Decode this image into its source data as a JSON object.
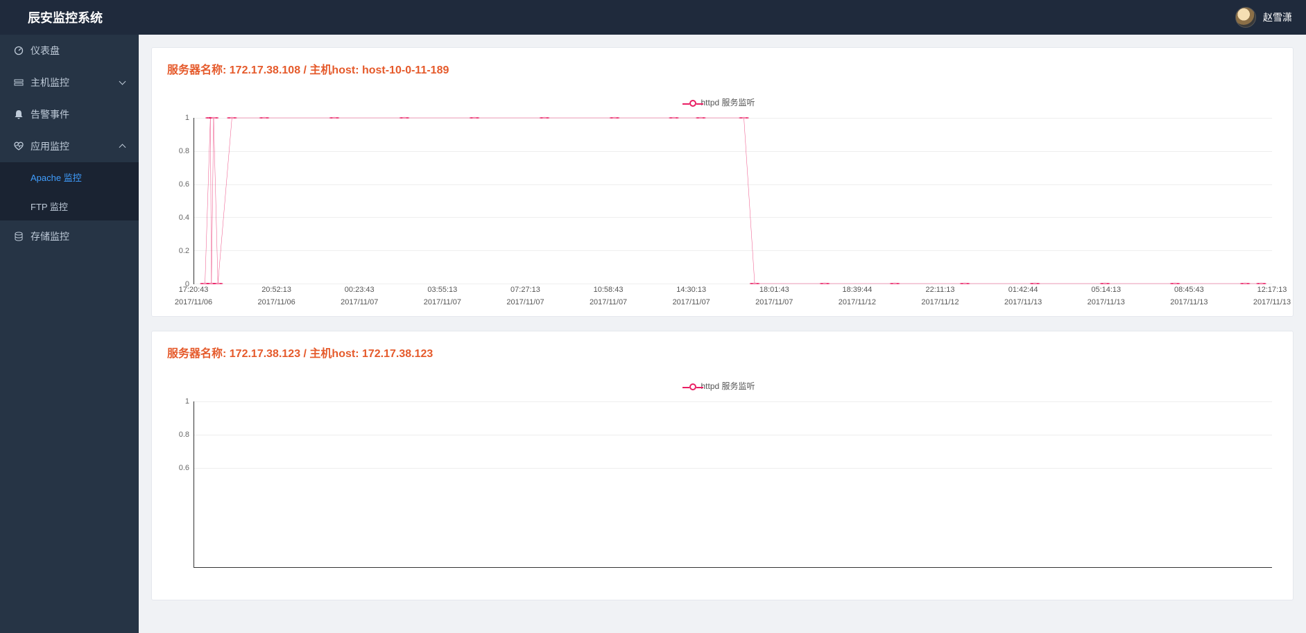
{
  "header": {
    "brand": "辰安监控系统",
    "username": "赵雪潇"
  },
  "sidebar": {
    "items": [
      {
        "icon": "dashboard",
        "label": "仪表盘"
      },
      {
        "icon": "host",
        "label": "主机监控",
        "arrow": true,
        "expanded": false
      },
      {
        "icon": "bell",
        "label": "告警事件"
      },
      {
        "icon": "heart",
        "label": "应用监控",
        "arrow": true,
        "expanded": true,
        "children": [
          {
            "label": "Apache 监控",
            "active": true
          },
          {
            "label": "FTP 监控"
          }
        ]
      },
      {
        "icon": "db",
        "label": "存储监控"
      }
    ]
  },
  "panels": [
    {
      "title": "服务器名称: 172.17.38.108 / 主机host: host-10-0-11-189",
      "legend": "httpd 服务监听"
    },
    {
      "title": "服务器名称: 172.17.38.123 / 主机host: 172.17.38.123",
      "legend": "httpd 服务监听"
    }
  ],
  "chart_data": [
    {
      "type": "line",
      "title": "服务器名称: 172.17.38.108 / 主机host: host-10-0-11-189",
      "series": [
        {
          "name": "httpd 服务监听",
          "values": [
            0,
            1,
            0,
            1,
            0,
            1,
            1,
            1,
            1,
            1,
            1,
            1,
            1,
            1,
            1,
            0,
            0,
            0,
            0,
            0,
            0,
            0,
            0,
            0,
            0,
            0,
            0,
            0
          ]
        }
      ],
      "x_pos": [
        0.01,
        0.015,
        0.016,
        0.018,
        0.022,
        0.035,
        0.065,
        0.13,
        0.195,
        0.26,
        0.325,
        0.39,
        0.445,
        0.47,
        0.51,
        0.52,
        0.585,
        0.65,
        0.715,
        0.78,
        0.845,
        0.91,
        0.975,
        0.99
      ],
      "yticks": [
        0,
        0.2,
        0.4,
        0.6,
        0.8,
        1
      ],
      "ylim": [
        0,
        1
      ],
      "x_labels": [
        {
          "t": "17:20:43",
          "d": "2017/11/06"
        },
        {
          "t": "20:52:13",
          "d": "2017/11/06"
        },
        {
          "t": "00:23:43",
          "d": "2017/11/07"
        },
        {
          "t": "03:55:13",
          "d": "2017/11/07"
        },
        {
          "t": "07:27:13",
          "d": "2017/11/07"
        },
        {
          "t": "10:58:43",
          "d": "2017/11/07"
        },
        {
          "t": "14:30:13",
          "d": "2017/11/07"
        },
        {
          "t": "18:01:43",
          "d": "2017/11/07"
        },
        {
          "t": "18:39:44",
          "d": "2017/11/12"
        },
        {
          "t": "22:11:13",
          "d": "2017/11/12"
        },
        {
          "t": "01:42:44",
          "d": "2017/11/13"
        },
        {
          "t": "05:14:13",
          "d": "2017/11/13"
        },
        {
          "t": "08:45:43",
          "d": "2017/11/13"
        },
        {
          "t": "12:17:13",
          "d": "2017/11/13"
        }
      ]
    },
    {
      "type": "line",
      "title": "服务器名称: 172.17.38.123 / 主机host: 172.17.38.123",
      "series": [
        {
          "name": "httpd 服务监听",
          "values": []
        }
      ],
      "yticks": [
        0.6,
        0.8,
        1
      ],
      "ylim": [
        0,
        1
      ],
      "x_labels": []
    }
  ]
}
